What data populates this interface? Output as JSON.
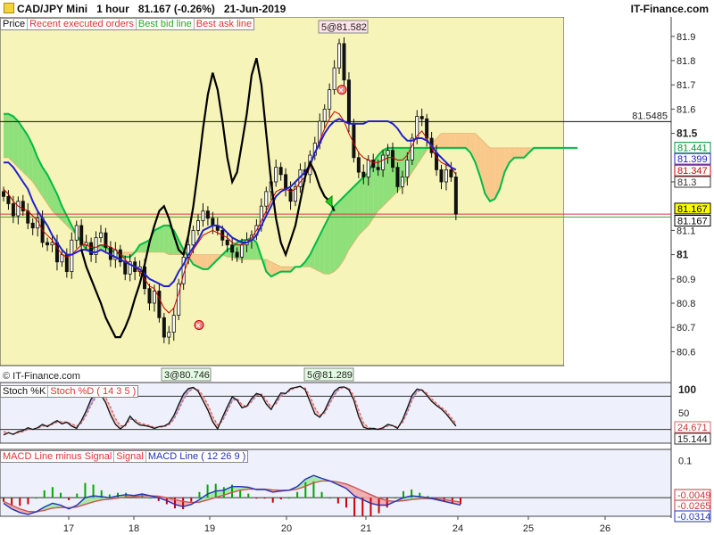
{
  "header": {
    "symbol": "CAD/JPY Mini",
    "timeframe": "1 hour",
    "last_price": "81.167",
    "change": "(-0.26%)",
    "date": "21-Jun-2019",
    "brand": "IT-Finance.com"
  },
  "footer": {
    "copyright": "© IT-Finance.com"
  },
  "colors": {
    "plot_bg": "#f6f4b8",
    "cloud_green": "#8ee07a",
    "cloud_orange": "#f8c98a",
    "tenkan": "#cc0000",
    "kijun": "#2222cc",
    "chikou": "#000000",
    "senkou_a": "#00bb44",
    "stoch_k": "#3333cc",
    "stoch_d": "#dd6666",
    "macd_up": "#00aa00",
    "macd_down": "#cc0000"
  },
  "legends": {
    "price": [
      "Price",
      "Recent executed orders",
      "Best bid line",
      "Best ask line"
    ],
    "stoch": [
      "Stoch %K",
      "Stoch %D ( 14 3 5 )"
    ],
    "macd": [
      "MACD Line minus Signal",
      "Signal",
      "MACD Line ( 12 26 9 )"
    ]
  },
  "chart_data": [
    {
      "type": "candlestick",
      "panel": "price",
      "ylim": [
        80.55,
        81.98
      ],
      "y_ticks": [
        "81.9",
        "81.8",
        "81.7",
        "81.6",
        "81.5",
        "81.3",
        "81.1",
        "81",
        "80.9",
        "80.8",
        "80.7",
        "80.6"
      ],
      "y_ticks_bold": [
        "81.5",
        "81"
      ],
      "x_ticks": [
        "17",
        "18",
        "19",
        "20",
        "21",
        "24",
        "25",
        "26"
      ],
      "close": [
        81.24,
        81.21,
        81.16,
        81.22,
        81.18,
        81.13,
        81.11,
        81.15,
        81.05,
        81.04,
        81.05,
        80.97,
        81.0,
        80.93,
        81.06,
        81.12,
        81.04,
        81.05,
        81.0,
        81.07,
        81.09,
        81.03,
        80.98,
        81.02,
        80.97,
        80.92,
        80.97,
        80.93,
        80.95,
        80.86,
        80.8,
        80.85,
        80.74,
        80.66,
        80.68,
        80.75,
        80.88,
        80.99,
        81.04,
        81.1,
        81.14,
        81.18,
        81.15,
        81.12,
        81.1,
        81.06,
        81.04,
        81.01,
        80.99,
        81.04,
        81.06,
        81.08,
        81.12,
        81.2,
        81.26,
        81.3,
        81.36,
        81.33,
        81.27,
        81.22,
        81.28,
        81.35,
        81.33,
        81.41,
        81.46,
        81.55,
        81.6,
        81.68,
        81.77,
        81.87,
        81.72,
        81.54,
        81.4,
        81.34,
        81.32,
        81.39,
        81.36,
        81.35,
        81.41,
        81.43,
        81.36,
        81.28,
        81.32,
        81.39,
        81.48,
        81.57,
        81.56,
        81.48,
        81.42,
        81.35,
        81.3,
        81.35,
        81.32,
        81.167
      ],
      "tenkan": [
        81.27,
        81.25,
        81.22,
        81.2,
        81.19,
        81.18,
        81.16,
        81.14,
        81.1,
        81.08,
        81.06,
        81.03,
        81.0,
        80.99,
        81.0,
        81.02,
        81.04,
        81.04,
        81.03,
        81.03,
        81.04,
        81.04,
        81.03,
        81.02,
        81.0,
        80.98,
        80.96,
        80.95,
        80.93,
        80.9,
        80.87,
        80.86,
        80.82,
        80.78,
        80.76,
        80.78,
        80.84,
        80.92,
        80.98,
        81.02,
        81.05,
        81.08,
        81.09,
        81.1,
        81.09,
        81.08,
        81.07,
        81.05,
        81.04,
        81.04,
        81.05,
        81.07,
        81.1,
        81.14,
        81.18,
        81.22,
        81.26,
        81.27,
        81.27,
        81.26,
        81.27,
        81.3,
        81.32,
        81.36,
        81.42,
        81.47,
        81.52,
        81.56,
        81.59,
        81.58,
        81.55,
        81.5,
        81.46,
        81.42,
        81.4,
        81.39,
        81.38,
        81.38,
        81.39,
        81.4,
        81.4,
        81.39,
        81.39,
        81.41,
        81.45,
        81.49,
        81.51,
        81.48,
        81.44,
        81.4,
        81.38,
        81.37,
        81.36,
        81.33
      ],
      "kijun": [
        81.38,
        81.38,
        81.36,
        81.33,
        81.3,
        81.27,
        81.22,
        81.18,
        81.15,
        81.12,
        81.08,
        81.05,
        81.02,
        81.0,
        81.0,
        81.01,
        81.02,
        81.02,
        81.01,
        81.01,
        81.02,
        81.01,
        81.0,
        80.99,
        80.98,
        80.97,
        80.96,
        80.95,
        80.94,
        80.92,
        80.9,
        80.89,
        80.88,
        80.87,
        80.87,
        80.89,
        80.93,
        80.96,
        81.0,
        81.03,
        81.06,
        81.1,
        81.11,
        81.12,
        81.12,
        81.11,
        81.09,
        81.07,
        81.06,
        81.05,
        81.05,
        81.06,
        81.08,
        81.12,
        81.16,
        81.2,
        81.24,
        81.26,
        81.27,
        81.28,
        81.3,
        81.32,
        81.34,
        81.37,
        81.42,
        81.46,
        81.5,
        81.53,
        81.55,
        81.56,
        81.55,
        81.54,
        81.54,
        81.54,
        81.54,
        81.55,
        81.55,
        81.55,
        81.55,
        81.55,
        81.54,
        81.52,
        81.49,
        81.47,
        81.47,
        81.48,
        81.48,
        81.47,
        81.45,
        81.42,
        81.4,
        81.38,
        81.36,
        81.35
      ],
      "chikou": [
        81.02,
        80.95,
        80.9,
        80.85,
        80.8,
        80.74,
        80.7,
        80.66,
        80.66,
        80.7,
        80.75,
        80.82,
        80.88,
        80.96,
        81.05,
        81.12,
        81.18,
        81.2,
        81.15,
        81.08,
        81.02,
        81.0,
        81.08,
        81.2,
        81.35,
        81.52,
        81.66,
        81.75,
        81.68,
        81.55,
        81.4,
        81.3,
        81.34,
        81.46,
        81.58,
        81.74,
        81.81,
        81.7,
        81.5,
        81.3,
        81.15,
        81.05,
        81.0,
        81.06,
        81.12,
        81.22,
        81.32,
        81.38,
        81.34,
        81.28,
        81.24,
        81.22,
        81.18
      ],
      "cloud_span_a": [
        81.58,
        81.58,
        81.57,
        81.55,
        81.52,
        81.49,
        81.45,
        81.4,
        81.36,
        81.33,
        81.29,
        81.25,
        81.2,
        81.16,
        81.12,
        81.08,
        81.05,
        81.02,
        81.02,
        81.03,
        81.04,
        81.03,
        81.02,
        81.01,
        81.0,
        80.99,
        80.99,
        81.01,
        81.04,
        81.05,
        81.06,
        81.1,
        81.11,
        81.12,
        81.12,
        81.1,
        81.06,
        81.02,
        80.99,
        80.96,
        80.95,
        80.94,
        80.94,
        80.96,
        80.98,
        81.0,
        81.02,
        81.03,
        81.05,
        81.06,
        81.06,
        81.07,
        81.05,
        80.99,
        80.93,
        80.91,
        80.92,
        80.93,
        80.93,
        80.93,
        80.95,
        80.95,
        80.97,
        81.0,
        81.04,
        81.08,
        81.12,
        81.16,
        81.2,
        81.22,
        81.24,
        81.26,
        81.28,
        81.3,
        81.32,
        81.34,
        81.38,
        81.41,
        81.43,
        81.44,
        81.44,
        81.44,
        81.44,
        81.44,
        81.44,
        81.44,
        81.44,
        81.44,
        81.44,
        81.44,
        81.44,
        81.44,
        81.44,
        81.44,
        81.44,
        81.44,
        81.42,
        81.38,
        81.32,
        81.25,
        81.22,
        81.23,
        81.27,
        81.34,
        81.38,
        81.4,
        81.4,
        81.4,
        81.42,
        81.44,
        81.44,
        81.44,
        81.44,
        81.44,
        81.44,
        81.44,
        81.44,
        81.44,
        81.44
      ],
      "cloud_span_b": [
        81.4,
        81.4,
        81.38,
        81.36,
        81.34,
        81.32,
        81.3,
        81.27,
        81.24,
        81.21,
        81.18,
        81.16,
        81.14,
        81.12,
        81.1,
        81.08,
        81.06,
        81.05,
        81.04,
        81.03,
        81.02,
        81.02,
        81.01,
        81.01,
        81.01,
        81.01,
        81.01,
        81.01,
        81.01,
        81.01,
        81.01,
        81.01,
        81.01,
        81.01,
        81.0,
        81.0,
        81.0,
        81.0,
        81.0,
        81.0,
        81.0,
        81.0,
        81.0,
        81.0,
        81.0,
        81.0,
        80.99,
        80.99,
        80.98,
        80.98,
        80.98,
        80.98,
        80.98,
        80.98,
        80.98,
        80.97,
        80.96,
        80.95,
        80.95,
        80.95,
        80.95,
        80.95,
        80.95,
        80.95,
        80.94,
        80.93,
        80.92,
        80.92,
        80.93,
        80.95,
        80.98,
        81.02,
        81.05,
        81.08,
        81.1,
        81.12,
        81.15,
        81.18,
        81.2,
        81.22,
        81.24,
        81.26,
        81.28,
        81.31,
        81.34,
        81.37,
        81.4,
        81.43,
        81.46,
        81.48,
        81.5,
        81.5,
        81.5,
        81.5,
        81.5,
        81.5,
        81.5,
        81.5,
        81.48,
        81.46,
        81.44,
        81.44,
        81.44,
        81.44,
        81.44,
        81.44,
        81.44,
        81.44,
        81.44,
        81.44,
        81.44,
        81.44,
        81.44,
        81.44,
        81.44,
        81.44,
        81.44,
        81.44,
        81.44
      ],
      "horizontal_lines": [
        {
          "value": 81.5485,
          "label": "81.5485"
        },
        {
          "value": 81.167,
          "label": ""
        },
        {
          "value": 81.155,
          "label": ""
        }
      ],
      "price_boxes": [
        {
          "label": "81.441",
          "value": 81.441,
          "bg": "#ffffff",
          "fg": "#009933"
        },
        {
          "label": "81.399",
          "value": 81.395,
          "bg": "#ffffff",
          "fg": "#2222cc"
        },
        {
          "label": "81.347",
          "value": 81.347,
          "bg": "#ffffff",
          "fg": "#cc0000"
        },
        {
          "label": "81.3",
          "value": 81.3,
          "bg": "#ffffff",
          "fg": "#333333"
        },
        {
          "label": "81.167",
          "value": 81.19,
          "bg": "#ffff00",
          "fg": "#000000"
        },
        {
          "label": "81.167",
          "value": 81.14,
          "bg": "#ffffff",
          "fg": "#000000"
        }
      ],
      "annotations": [
        {
          "label": "5@81.582",
          "at": 81.582
        },
        {
          "label": "3@80.746",
          "at": 80.746
        },
        {
          "label": "5@81.289",
          "at": 81.289
        }
      ]
    },
    {
      "type": "line",
      "panel": "stochastic",
      "ylim": [
        0,
        100
      ],
      "y_ticks": [
        "100",
        "50"
      ],
      "k": [
        10,
        14,
        11,
        16,
        18,
        23,
        20,
        23,
        29,
        25,
        31,
        36,
        30,
        33,
        26,
        22,
        36,
        54,
        75,
        85,
        83,
        68,
        46,
        29,
        21,
        28,
        44,
        34,
        28,
        27,
        25,
        22,
        25,
        26,
        31,
        45,
        65,
        84,
        94,
        96,
        89,
        72,
        55,
        34,
        21,
        42,
        61,
        79,
        73,
        59,
        62,
        76,
        85,
        82,
        66,
        56,
        72,
        86,
        85,
        94,
        96,
        98,
        92,
        70,
        48,
        42,
        54,
        73,
        89,
        96,
        97,
        92,
        73,
        43,
        24,
        21,
        22,
        20,
        23,
        29,
        27,
        22,
        37,
        59,
        82,
        93,
        91,
        82,
        71,
        63,
        57,
        48,
        37,
        26
      ],
      "d": [
        16,
        14,
        12,
        14,
        16,
        20,
        21,
        22,
        26,
        27,
        29,
        33,
        34,
        33,
        30,
        26,
        31,
        46,
        64,
        79,
        85,
        78,
        60,
        40,
        27,
        26,
        38,
        38,
        32,
        29,
        27,
        24,
        24,
        25,
        28,
        38,
        55,
        74,
        88,
        94,
        92,
        81,
        65,
        44,
        28,
        35,
        53,
        71,
        76,
        65,
        61,
        70,
        81,
        84,
        73,
        61,
        66,
        80,
        85,
        91,
        95,
        97,
        95,
        80,
        59,
        46,
        49,
        65,
        82,
        93,
        96,
        95,
        81,
        55,
        32,
        23,
        22,
        21,
        22,
        26,
        27,
        24,
        32,
        50,
        73,
        88,
        92,
        86,
        76,
        67,
        60,
        53,
        42,
        31
      ],
      "last_values": {
        "d": "24.671",
        "k": "15.144"
      },
      "levels": [
        20,
        80
      ]
    },
    {
      "type": "bar_line",
      "panel": "macd",
      "ylim": [
        -0.05,
        0.13
      ],
      "y_ticks": [
        "0.1"
      ],
      "macd": [
        -0.015,
        -0.03,
        -0.04,
        -0.045,
        -0.038,
        -0.025,
        -0.015,
        -0.02,
        -0.03,
        -0.02,
        0.0,
        0.005,
        0.003,
        0.0,
        0.005,
        0.008,
        0.006,
        0.01,
        0.005,
        0.0,
        -0.008,
        -0.018,
        -0.024,
        -0.018,
        -0.005,
        0.01,
        0.018,
        0.02,
        0.03,
        0.03,
        0.028,
        0.022,
        0.022,
        0.015,
        0.018,
        0.02,
        0.03,
        0.05,
        0.06,
        0.052,
        0.045,
        0.035,
        0.025,
        0.005,
        -0.005,
        -0.015,
        -0.02,
        -0.02,
        -0.01,
        0.0,
        0.005,
        0.003,
        0.0,
        -0.005,
        -0.01,
        -0.015,
        -0.02
      ],
      "signal": [
        -0.01,
        -0.02,
        -0.03,
        -0.037,
        -0.038,
        -0.034,
        -0.028,
        -0.026,
        -0.027,
        -0.025,
        -0.018,
        -0.011,
        -0.006,
        -0.004,
        -0.001,
        0.002,
        0.003,
        0.005,
        0.005,
        0.004,
        0.0,
        -0.005,
        -0.01,
        -0.013,
        -0.012,
        -0.006,
        0.001,
        0.007,
        0.014,
        0.02,
        0.023,
        0.023,
        0.023,
        0.021,
        0.02,
        0.02,
        0.023,
        0.031,
        0.04,
        0.045,
        0.045,
        0.042,
        0.037,
        0.028,
        0.018,
        0.008,
        -0.001,
        -0.008,
        -0.01,
        -0.008,
        -0.005,
        -0.003,
        -0.002,
        -0.003,
        -0.005,
        -0.008,
        -0.012
      ],
      "last_values": {
        "signal": "-0.0049",
        "histogram": "-0.0265",
        "macd": "-0.0314"
      },
      "levels": [
        0
      ]
    }
  ]
}
